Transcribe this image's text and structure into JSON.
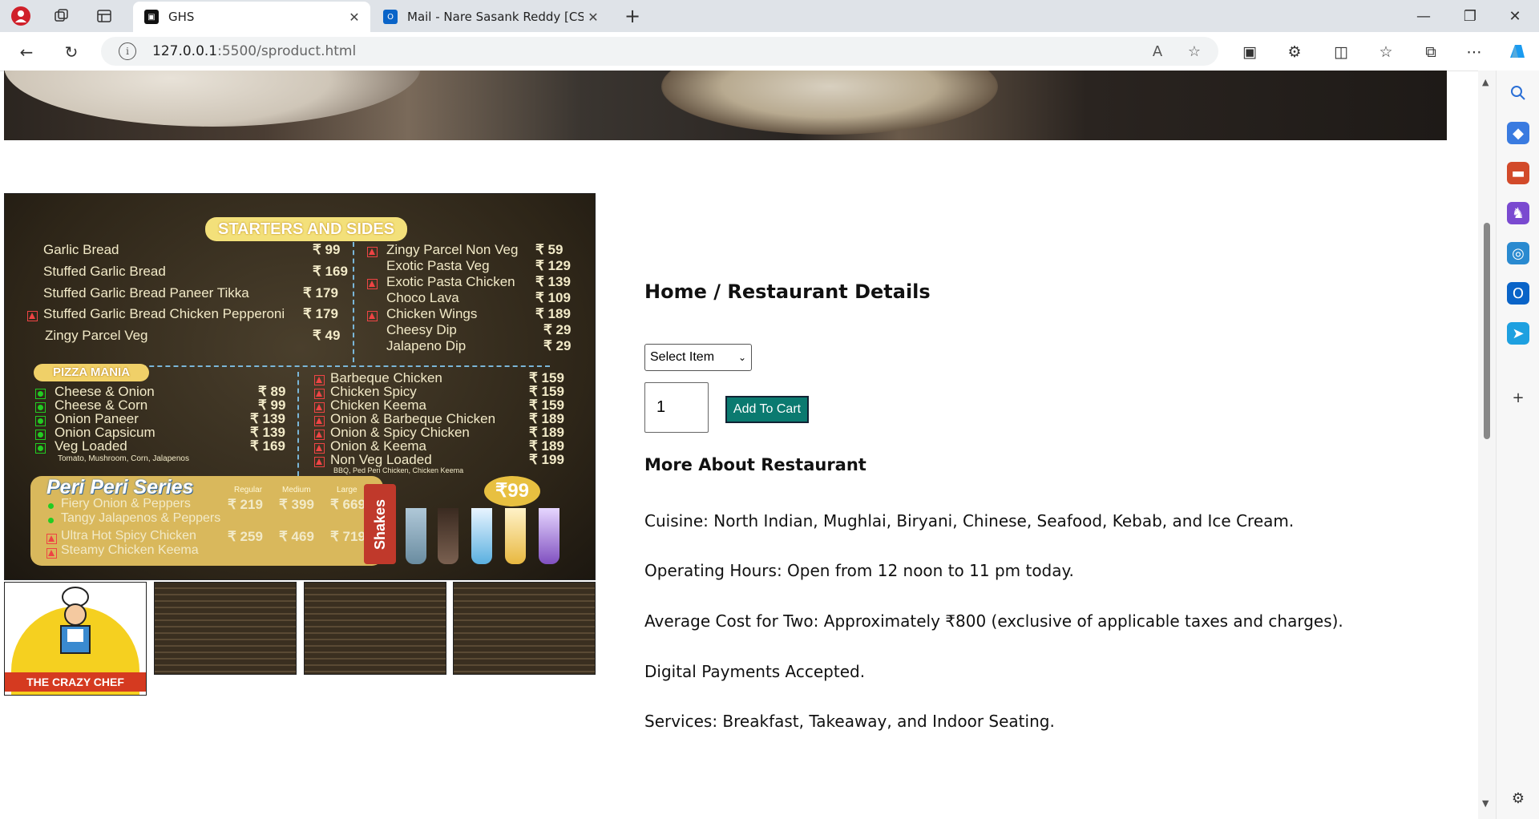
{
  "browser": {
    "tabs": [
      {
        "title": "GHS",
        "favicon": "ghs-favicon"
      },
      {
        "title": "Mail - Nare Sasank Reddy [CSE -",
        "favicon": "outlook-favicon"
      }
    ],
    "url_host": "127.0.0.1",
    "url_rest": ":5500/sproduct.html",
    "new_tab_label": "+"
  },
  "page": {
    "breadcrumb": "Home / Restaurant Details",
    "select_default": "Select Item",
    "quantity": "1",
    "add_to_cart": "Add To Cart",
    "more_title": "More About Restaurant",
    "details": [
      "Cuisine: North Indian, Mughlai, Biryani, Chinese, Seafood, Kebab, and Ice Cream.",
      "Operating Hours: Open from 12 noon to 11 pm today.",
      "Average Cost for Two: Approximately ₹800 (exclusive of applicable taxes and charges).",
      "Digital Payments Accepted.",
      "Services: Breakfast, Takeaway, and Indoor Seating."
    ]
  },
  "menu_image": {
    "banner": "STARTERS AND SIDES",
    "left_items": [
      {
        "name": "Garlic Bread",
        "price": "₹ 99"
      },
      {
        "name": "Stuffed Garlic Bread",
        "price": "₹ 169"
      },
      {
        "name": "Stuffed Garlic Bread Paneer Tikka",
        "price": "₹ 179"
      },
      {
        "name": "Stuffed Garlic Bread Chicken Pepperoni",
        "price": "₹ 179"
      },
      {
        "name": "Zingy Parcel Veg",
        "price": "₹ 49"
      }
    ],
    "right_items": [
      {
        "name": "Zingy Parcel Non Veg",
        "price": "₹ 59"
      },
      {
        "name": "Exotic Pasta Veg",
        "price": "₹ 129"
      },
      {
        "name": "Exotic Pasta Chicken",
        "price": "₹ 139"
      },
      {
        "name": "Chicken Wings",
        "price": "₹ 189"
      },
      {
        "name": "Choco Lava",
        "price": "₹ 109"
      },
      {
        "name": "Cheesy Dip",
        "price": "₹ 29"
      },
      {
        "name": "Jalapeno Dip",
        "price": "₹ 29"
      }
    ],
    "pizza_banner": "PIZZA MANIA",
    "pizza_veg": [
      {
        "name": "Cheese & Onion",
        "price": "₹ 89"
      },
      {
        "name": "Cheese & Corn",
        "price": "₹ 99"
      },
      {
        "name": "Onion Paneer",
        "price": "₹ 139"
      },
      {
        "name": "Onion Capsicum",
        "price": "₹ 139"
      },
      {
        "name": "Veg Loaded",
        "price": "₹ 169"
      }
    ],
    "veg_loaded_note": "Tomato, Mushroom, Corn, Jalapenos",
    "pizza_nonveg": [
      {
        "name": "Barbeque Chicken",
        "price": "₹ 159"
      },
      {
        "name": "Chicken Spicy",
        "price": "₹ 159"
      },
      {
        "name": "Chicken Keema",
        "price": "₹ 159"
      },
      {
        "name": "Onion & Barbeque Chicken",
        "price": "₹ 189"
      },
      {
        "name": "Onion & Spicy Chicken",
        "price": "₹ 189"
      },
      {
        "name": "Onion & Keema",
        "price": "₹ 189"
      },
      {
        "name": "Non Veg Loaded",
        "price": "₹ 199"
      }
    ],
    "nonveg_loaded_note": "BBQ, Ped Peri Chicken, Chicken Keema",
    "peri_title": "Peri Peri Series",
    "peri_sizes": [
      "Regular",
      "Medium",
      "Large"
    ],
    "peri_items": [
      "Fiery Onion & Peppers",
      "Tangy Jalapenos & Peppers",
      "Ultra Hot Spicy Chicken",
      "Steamy Chicken Keema"
    ],
    "peri_veg_prices": [
      "₹ 219",
      "₹ 399",
      "₹ 669"
    ],
    "peri_nonveg_prices": [
      "₹ 259",
      "₹ 469",
      "₹ 719"
    ],
    "shakes_label": "Shakes",
    "shakes_price": "₹99"
  },
  "thumbnails": {
    "logo_text": "THE CRAZY CHEF"
  }
}
